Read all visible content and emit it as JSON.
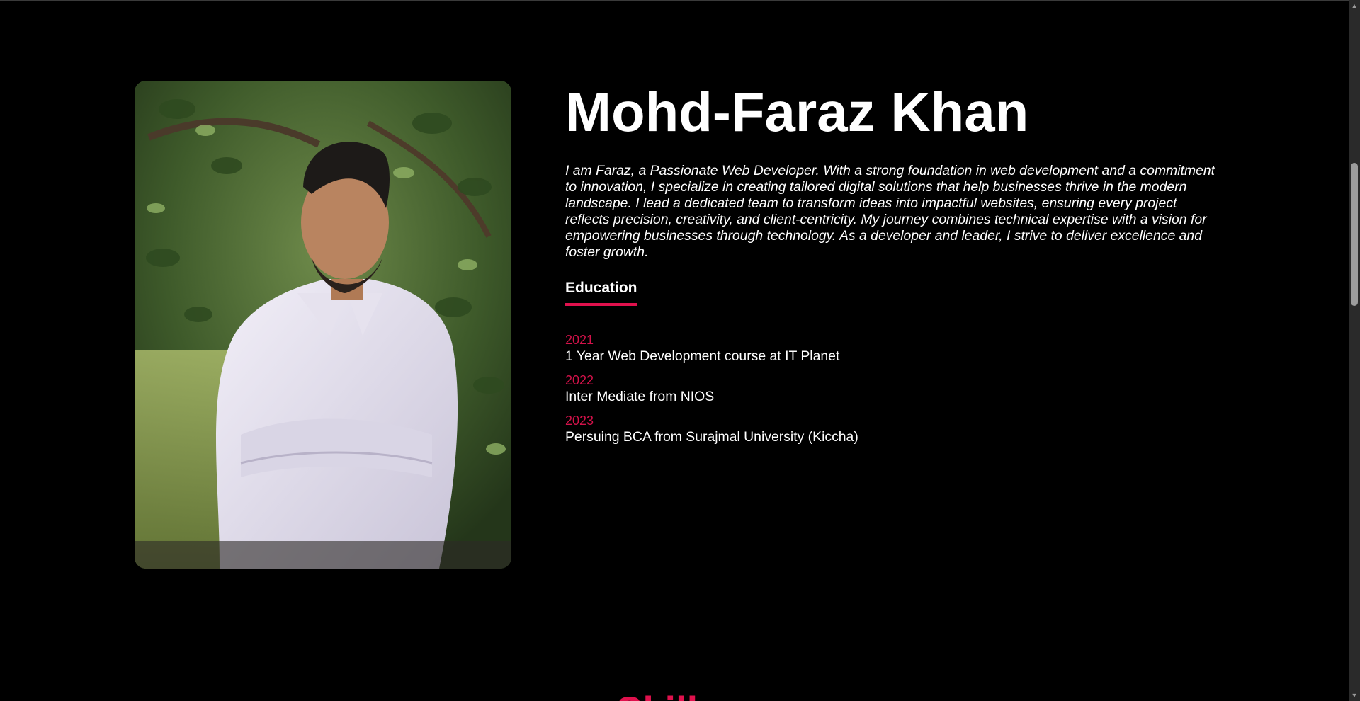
{
  "profile": {
    "name": "Mohd-Faraz Khan",
    "bio": "I am Faraz, a Passionate Web Developer. With a strong foundation in web development and a commitment to innovation, I specialize in creating tailored digital solutions that help businesses thrive in the modern landscape. I lead a dedicated team to transform ideas into impactful websites, ensuring every project reflects precision, creativity, and client-centricity. My journey combines technical expertise with a vision for empowering businesses through technology. As a developer and leader, I strive to deliver excellence and foster growth."
  },
  "education": {
    "heading": "Education",
    "items": [
      {
        "year": "2021",
        "description": "1 Year Web Development course at IT Planet"
      },
      {
        "year": "2022",
        "description": "Inter Mediate from NIOS"
      },
      {
        "year": "2023",
        "description": "Persuing BCA from Surajmal University (Kiccha)"
      }
    ]
  },
  "next_section": {
    "title": "Skills"
  },
  "colors": {
    "accent": "#e0114d",
    "background": "#000000",
    "text": "#ffffff"
  },
  "icons": {
    "scroll_up": "chevron-up-icon",
    "scroll_down": "chevron-down-icon"
  }
}
